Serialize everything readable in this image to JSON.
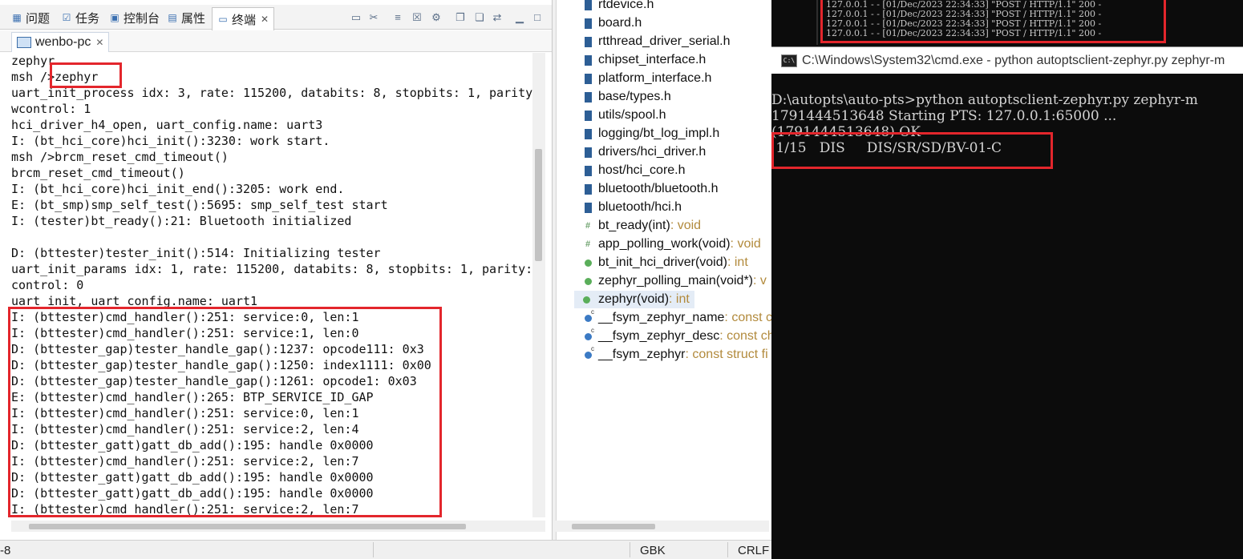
{
  "left_pane": {
    "view_tabs": [
      {
        "label": "问题",
        "icon": "problems-icon"
      },
      {
        "label": "任务",
        "icon": "tasks-icon"
      },
      {
        "label": "控制台",
        "icon": "console-icon"
      },
      {
        "label": "属性",
        "icon": "properties-icon"
      },
      {
        "label": "终端",
        "icon": "terminal-icon"
      }
    ],
    "session_tab": "wenbo-pc",
    "terminal_lines": [
      "zephyr",
      "msh />zephyr",
      "uart_init_process idx: 3, rate: 115200, databits: 8, stopbits: 1, parity",
      "wcontrol: 1",
      "hci_driver_h4_open, uart_config.name: uart3",
      "I: (bt_hci_core)hci_init():3230: work start.",
      "msh />brcm_reset_cmd_timeout()",
      "brcm_reset_cmd_timeout()",
      "I: (bt_hci_core)hci_init_end():3205: work end.",
      "E: (bt_smp)smp_self_test():5695: smp_self_test start",
      "I: (tester)bt_ready():21: Bluetooth initialized",
      "",
      "D: (bttester)tester_init():514: Initializing tester",
      "uart_init_params idx: 1, rate: 115200, databits: 8, stopbits: 1, parity:",
      "control: 0",
      "uart_init, uart_config.name: uart1",
      "I: (bttester)cmd_handler():251: service:0, len:1",
      "I: (bttester)cmd_handler():251: service:1, len:0",
      "D: (bttester_gap)tester_handle_gap():1237: opcode111: 0x3",
      "D: (bttester_gap)tester_handle_gap():1250: index1111: 0x00",
      "D: (bttester_gap)tester_handle_gap():1261: opcode1: 0x03",
      "E: (bttester)cmd_handler():265: BTP_SERVICE_ID_GAP",
      "I: (bttester)cmd_handler():251: service:0, len:1",
      "I: (bttester)cmd_handler():251: service:2, len:4",
      "D: (bttester_gatt)gatt_db_add():195: handle 0x0000",
      "I: (bttester)cmd_handler():251: service:2, len:7",
      "D: (bttester_gatt)gatt_db_add():195: handle 0x0000",
      "D: (bttester_gatt)gatt_db_add():195: handle 0x0000",
      "I: (bttester)cmd_handler():251: service:2, len:7"
    ]
  },
  "outline": {
    "items": [
      {
        "name": "rtdevice.h",
        "type": "",
        "kind": "include"
      },
      {
        "name": "board.h",
        "type": "",
        "kind": "include"
      },
      {
        "name": "rtthread_driver_serial.h",
        "type": "",
        "kind": "include"
      },
      {
        "name": "chipset_interface.h",
        "type": "",
        "kind": "include"
      },
      {
        "name": "platform_interface.h",
        "type": "",
        "kind": "include"
      },
      {
        "name": "base/types.h",
        "type": "",
        "kind": "include"
      },
      {
        "name": "utils/spool.h",
        "type": "",
        "kind": "include"
      },
      {
        "name": "logging/bt_log_impl.h",
        "type": "",
        "kind": "include"
      },
      {
        "name": "drivers/hci_driver.h",
        "type": "",
        "kind": "include"
      },
      {
        "name": "host/hci_core.h",
        "type": "",
        "kind": "include"
      },
      {
        "name": "bluetooth/bluetooth.h",
        "type": "",
        "kind": "include"
      },
      {
        "name": "bluetooth/hci.h",
        "type": "",
        "kind": "include"
      },
      {
        "name": "bt_ready(int)",
        "type": " : void",
        "kind": "hash"
      },
      {
        "name": "app_polling_work(void)",
        "type": " : void",
        "kind": "hash"
      },
      {
        "name": "bt_init_hci_driver(void)",
        "type": " : int",
        "kind": "function"
      },
      {
        "name": "zephyr_polling_main(void*)",
        "type": " : v",
        "kind": "function"
      },
      {
        "name": "zephyr(void)",
        "type": " : int",
        "kind": "function"
      },
      {
        "name": "__fsym_zephyr_name",
        "type": " : const c",
        "kind": "variable"
      },
      {
        "name": "__fsym_zephyr_desc",
        "type": " : const ch",
        "kind": "variable"
      },
      {
        "name": "__fsym_zephyr",
        "type": " : const struct fi",
        "kind": "variable"
      }
    ],
    "selected": "zephyr(void)"
  },
  "status_bar": {
    "left_text": "-8",
    "encoding": "GBK",
    "line_ending": "CRLF"
  },
  "background_console": {
    "lines": [
      "127.0.0.1 - - [01/Dec/2023 22:34:33] \"POST / HTTP/1.1\" 200 -",
      "127.0.0.1 - - [01/Dec/2023 22:34:33] \"POST / HTTP/1.1\" 200 -",
      "127.0.0.1 - - [01/Dec/2023 22:34:33] \"POST / HTTP/1.1\" 200 -",
      "127.0.0.1 - - [01/Dec/2023 22:34:33] \"POST / HTTP/1.1\" 200 -"
    ]
  },
  "cmd_window": {
    "title": "C:\\Windows\\System32\\cmd.exe - python  autoptsclient-zephyr.py zephyr-m",
    "lines": [
      "D:\\autopts\\auto-pts>python autoptsclient-zephyr.py zephyr-m",
      "1791444513648 Starting PTS: 127.0.0.1:65000 ...",
      "(1791444513648) OK",
      " 1/15   DIS     DIS/SR/SD/BV-01-C"
    ]
  },
  "colors": {
    "highlight_box": "#e3262c",
    "terminal_bg": "#0c0c0c",
    "type_text": "#b28a3c"
  }
}
